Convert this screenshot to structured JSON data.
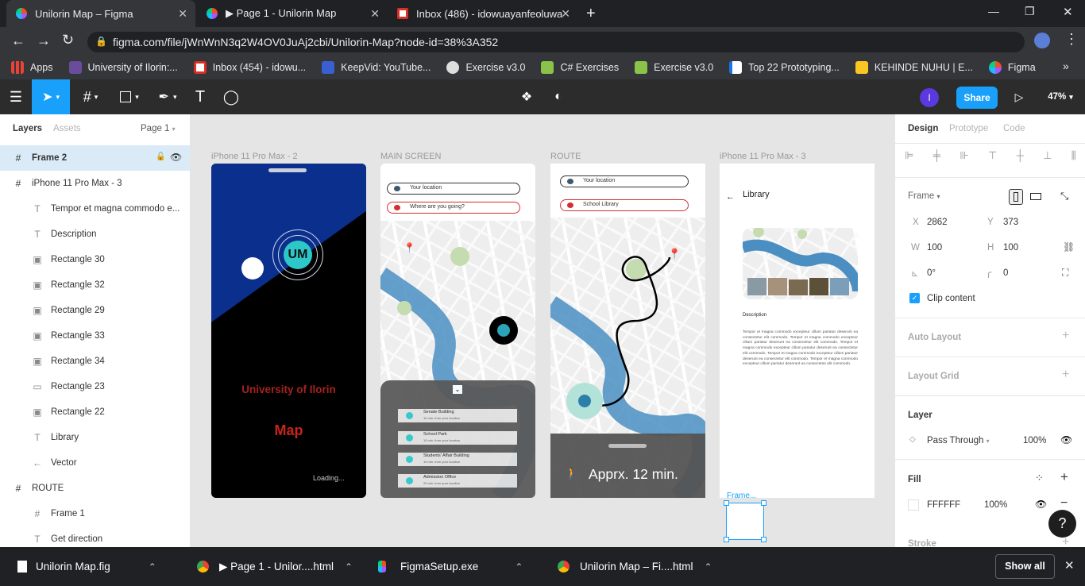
{
  "browser": {
    "tabs": [
      {
        "title": "Unilorin Map – Figma"
      },
      {
        "title": "▶ Page 1 - Unilorin Map"
      },
      {
        "title": "Inbox (486) - idowuayanfeoluwa@"
      }
    ],
    "url": "figma.com/file/jWnWnN3q2W4OV0JuAj2cbi/Unilorin-Map?node-id=38%3A352",
    "bookmarks": [
      {
        "label": "Apps"
      },
      {
        "label": "University of Ilorin:..."
      },
      {
        "label": "Inbox (454) - idowu..."
      },
      {
        "label": "KeepVid: YouTube..."
      },
      {
        "label": "Exercise v3.0"
      },
      {
        "label": "C# Exercises"
      },
      {
        "label": "Exercise v3.0"
      },
      {
        "label": "Top 22 Prototyping..."
      },
      {
        "label": "KEHINDE NUHU | E..."
      },
      {
        "label": "Figma"
      }
    ]
  },
  "figma": {
    "toolbar": {
      "avatar_initial": "I",
      "share_label": "Share",
      "zoom": "47%"
    },
    "left": {
      "tabs": {
        "layers": "Layers",
        "assets": "Assets",
        "page": "Page 1"
      },
      "layers": [
        {
          "icon": "#",
          "label": "Frame 2"
        },
        {
          "icon": "#",
          "label": "iPhone 11 Pro Max - 3"
        },
        {
          "icon": "T",
          "label": "Tempor et magna commodo e..."
        },
        {
          "icon": "T",
          "label": "Description"
        },
        {
          "icon": "▣",
          "label": "Rectangle 30"
        },
        {
          "icon": "▣",
          "label": "Rectangle 32"
        },
        {
          "icon": "▣",
          "label": "Rectangle 29"
        },
        {
          "icon": "▣",
          "label": "Rectangle 33"
        },
        {
          "icon": "▣",
          "label": "Rectangle 34"
        },
        {
          "icon": "▭",
          "label": "Rectangle 23"
        },
        {
          "icon": "▣",
          "label": "Rectangle 22"
        },
        {
          "icon": "T",
          "label": "Library"
        },
        {
          "icon": "←",
          "label": "Vector"
        },
        {
          "icon": "#",
          "label": "ROUTE"
        },
        {
          "icon": "#",
          "label": "Frame 1"
        },
        {
          "icon": "T",
          "label": "Get direction"
        }
      ]
    },
    "right": {
      "tabs": {
        "design": "Design",
        "prototype": "Prototype",
        "code": "Code"
      },
      "frame_label": "Frame",
      "x_label": "X",
      "x": "2862",
      "y_label": "Y",
      "y": "373",
      "w_label": "W",
      "w": "100",
      "h_label": "H",
      "h": "100",
      "rotation": "0°",
      "radius": "0",
      "clip_content": "Clip content",
      "auto_layout": "Auto Layout",
      "layout_grid": "Layout Grid",
      "layer": "Layer",
      "blend": "Pass Through",
      "layer_opacity": "100%",
      "fill": "Fill",
      "fill_hex": "FFFFFF",
      "fill_opacity": "100%",
      "stroke": "Stroke",
      "help": "?"
    },
    "canvas": {
      "frames": [
        {
          "label": "iPhone 11 Pro Max - 2"
        },
        {
          "label": "MAIN SCREEN"
        },
        {
          "label": "ROUTE"
        },
        {
          "label": "iPhone 11 Pro Max - 3"
        }
      ],
      "splash": {
        "logo": "UM",
        "title": "University of Ilorin",
        "subtitle": "Map",
        "loading": "Loading..."
      },
      "main": {
        "your_location": "Your location",
        "where_going": "Where are you going?",
        "places": [
          {
            "name": "Senate Building",
            "meta": "10 min. from your location"
          },
          {
            "name": "School Park",
            "meta": "10 min. from your location"
          },
          {
            "name": "Students' Affair Building",
            "meta": "15 min. from your location"
          },
          {
            "name": "Admission Office",
            "meta": "20 min. from your location"
          }
        ]
      },
      "route": {
        "your_location": "Your location",
        "destination": "School Library",
        "eta": "Apprx. 12 min."
      },
      "library": {
        "title": "Library",
        "description_label": "Description",
        "body": "Tempor et magna commodo excepteur cillum pariatur deserunt ea consectetur elit commodo. Tempor et magna commodo excepteur cillum pariatur deserunt ea consectetur elit commodo. Tempor et magna commodo excepteur cillum pariatur deserunt ea consectetur elit commodo. Tempor et magna commodo excepteur cillum pariatur deserunt ea consectetur elit commodo. Tempor et magna commodo excepteur cillum pariatur deserunt ea consectetur elit commodo."
      },
      "selected_frame_label": "Frame..."
    }
  },
  "taskbar": {
    "items": [
      {
        "label": "Unilorin Map.fig"
      },
      {
        "label": "▶ Page 1 - Unilor....html"
      },
      {
        "label": "FigmaSetup.exe"
      },
      {
        "label": "Unilorin Map – Fi....html"
      }
    ],
    "show_all": "Show all"
  },
  "colors": {
    "figma_blue": "#18a0fb",
    "splash_blue": "#0b2f8c",
    "teal": "#2ec7c9",
    "red": "#d32f2f"
  }
}
